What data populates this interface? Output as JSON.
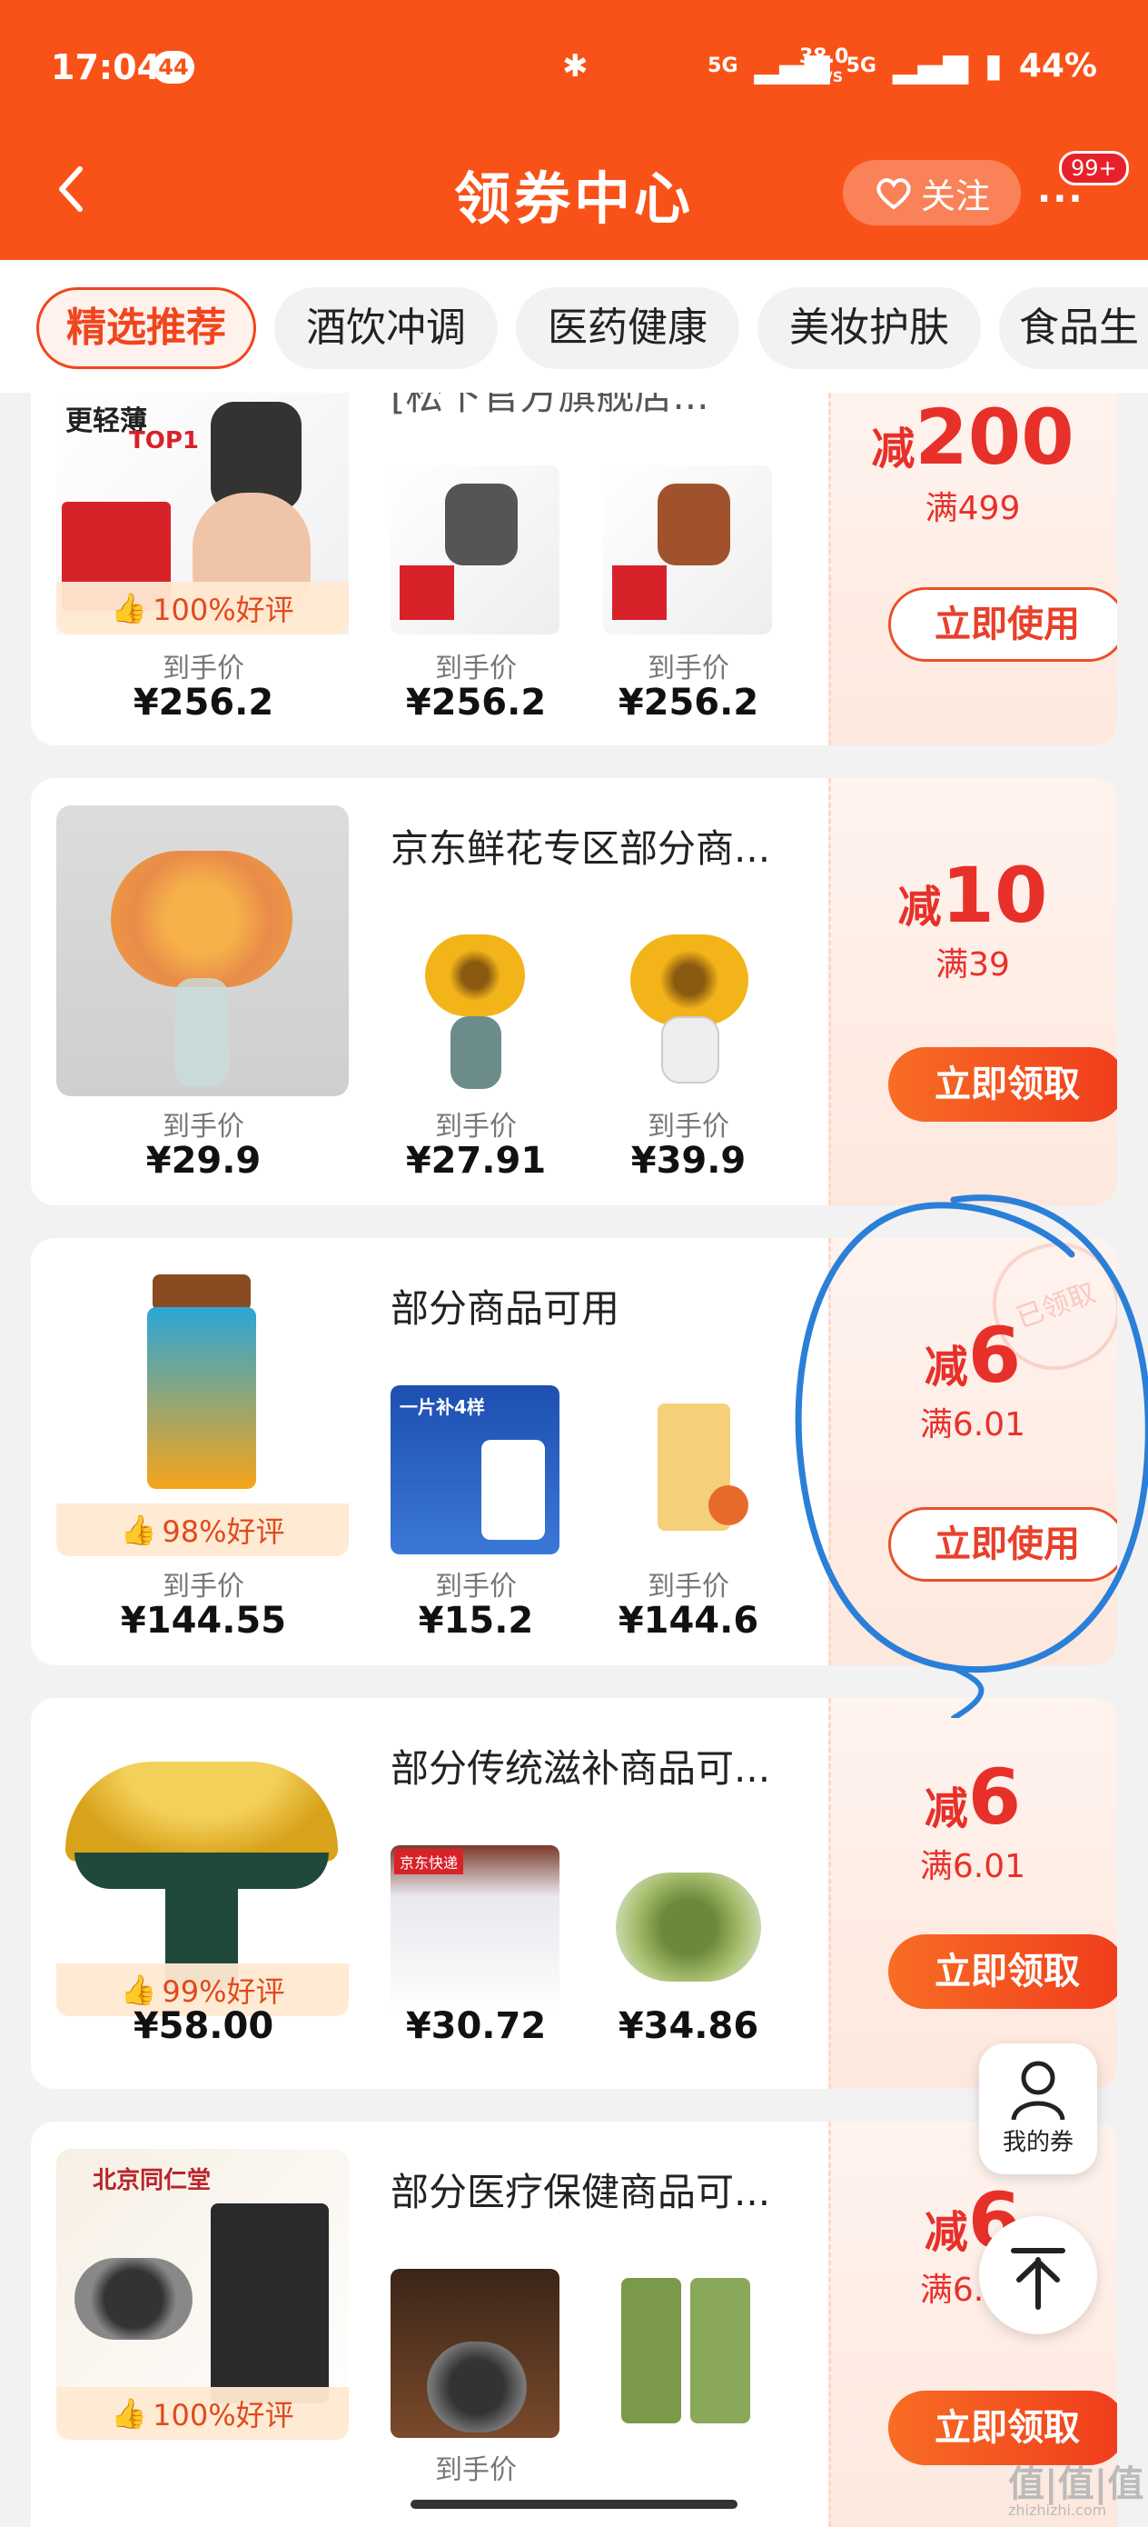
{
  "status_bar": {
    "time": "17:04",
    "notif_count": "44",
    "net_speed": "38.0",
    "net_unit": "KB/S",
    "signal": "5G",
    "battery": "44%"
  },
  "nav": {
    "title": "领券中心",
    "follow_label": "关注",
    "more": "···",
    "msg_badge": "99+"
  },
  "tabs": [
    "精选推荐",
    "酒饮冲调",
    "医药健康",
    "美妆护肤",
    "食品生"
  ],
  "cards": [
    {
      "title": "[松下官方旗舰店...",
      "rating": "100%好评",
      "coupon_pre": "减",
      "coupon_value": "200",
      "coupon_cond": "满499",
      "button": "立即使用",
      "products": [
        {
          "label": "到手价",
          "price": "¥256.2"
        },
        {
          "label": "到手价",
          "price": "¥256.2"
        },
        {
          "label": "到手价",
          "price": "¥256.2"
        }
      ]
    },
    {
      "title": "京东鲜花专区部分商...",
      "rating": "",
      "coupon_pre": "减",
      "coupon_value": "10",
      "coupon_cond": "满39",
      "button": "立即领取",
      "products": [
        {
          "label": "到手价",
          "price": "¥29.9"
        },
        {
          "label": "到手价",
          "price": "¥27.91"
        },
        {
          "label": "到手价",
          "price": "¥39.9"
        }
      ]
    },
    {
      "title": "部分商品可用",
      "rating": "98%好评",
      "coupon_pre": "减",
      "coupon_value": "6",
      "coupon_cond": "满6.01",
      "button": "立即使用",
      "stamp": "已领取",
      "products": [
        {
          "label": "到手价",
          "price": "¥144.55"
        },
        {
          "label": "到手价",
          "price": "¥15.2"
        },
        {
          "label": "到手价",
          "price": "¥144.6"
        }
      ]
    },
    {
      "title": "部分传统滋补商品可...",
      "rating": "99%好评",
      "coupon_pre": "减",
      "coupon_value": "6",
      "coupon_cond": "满6.01",
      "button": "立即领取",
      "products": [
        {
          "label": "",
          "price": "¥58.00"
        },
        {
          "label": "",
          "price": "¥30.72"
        },
        {
          "label": "",
          "price": "¥34.86"
        }
      ]
    },
    {
      "title": "部分医疗保健商品可...",
      "rating": "100%好评",
      "coupon_pre": "减",
      "coupon_value": "6",
      "coupon_cond": "满6.01",
      "button": "立即领取",
      "products": [
        {
          "label": "",
          "price": ""
        },
        {
          "label": "到手价",
          "price": ""
        },
        {
          "label": "",
          "price": ""
        }
      ]
    }
  ],
  "floating": {
    "my_coupons": "我的券"
  },
  "watermark": {
    "text": "值|值|值",
    "site": "zhizhizhi.com"
  },
  "product_texts": {
    "panasonic_top": "更轻薄",
    "panasonic_sub": "TOP1",
    "jd_express": "京东快递",
    "supplement_banner": "一片补4样",
    "tongrentang": "北京同仁堂"
  },
  "colors": {
    "brand": "#f95218",
    "coupon_red": "#e8302a",
    "annotation_blue": "#2a7fd8"
  }
}
